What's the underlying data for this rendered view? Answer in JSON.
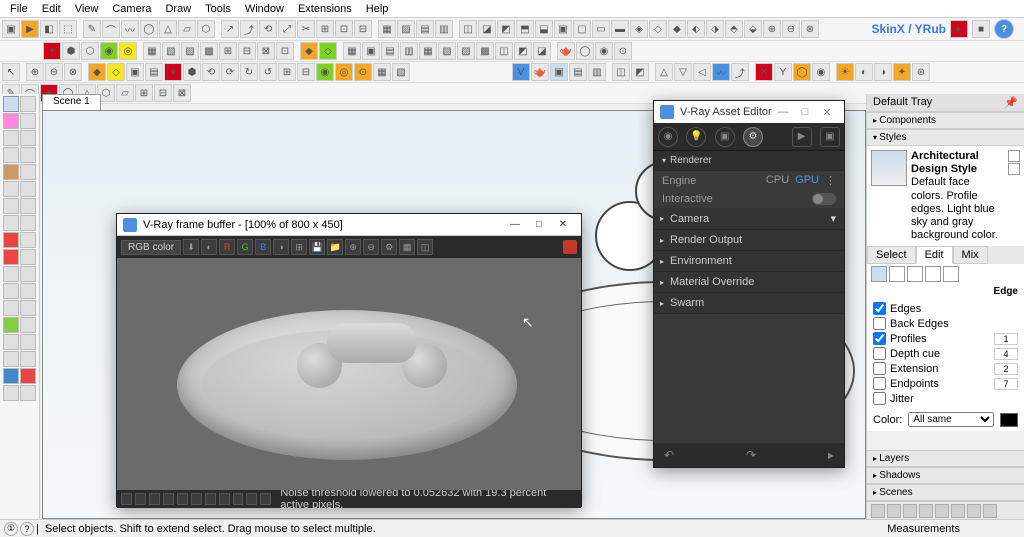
{
  "menu": [
    "File",
    "Edit",
    "View",
    "Camera",
    "Draw",
    "Tools",
    "Window",
    "Extensions",
    "Help"
  ],
  "skinx_label": "SkinX / YRub",
  "scene_tab": "Scene 1",
  "vfb": {
    "title": "V-Ray frame buffer - [100% of 800 x 450]",
    "channel": "RGB color",
    "status": "Noise threshold lowered to 0.052632 with 19.3 percent active pixels."
  },
  "vae": {
    "title": "V-Ray Asset Editor",
    "section_renderer": "Renderer",
    "engine_label": "Engine",
    "cpu": "CPU",
    "gpu": "GPU",
    "interactive_label": "Interactive",
    "sections": {
      "camera": "Camera",
      "render_output": "Render Output",
      "environment": "Environment",
      "material_override": "Material Override",
      "swarm": "Swarm"
    }
  },
  "tray": {
    "title": "Default Tray",
    "panels": {
      "components": "Components",
      "styles": "Styles",
      "layers": "Layers",
      "shadows": "Shadows",
      "scenes": "Scenes"
    },
    "style_name": "Architectural Design Style",
    "style_desc": "Default face colors. Profile edges. Light blue sky and gray background color.",
    "tabs": {
      "select": "Select",
      "edit": "Edit",
      "mix": "Mix"
    },
    "edge_label": "Edge",
    "checks": {
      "edges": "Edges",
      "back_edges": "Back Edges",
      "profiles": "Profiles",
      "depth_cue": "Depth cue",
      "extension": "Extension",
      "endpoints": "Endpoints",
      "jitter": "Jitter"
    },
    "values": {
      "profiles": "1",
      "depth_cue": "4",
      "extension": "2",
      "endpoints": "7"
    },
    "color_label": "Color:",
    "color_mode": "All same"
  },
  "status": {
    "hint": "Select objects. Shift to extend select. Drag mouse to select multiple.",
    "measurements": "Measurements"
  }
}
